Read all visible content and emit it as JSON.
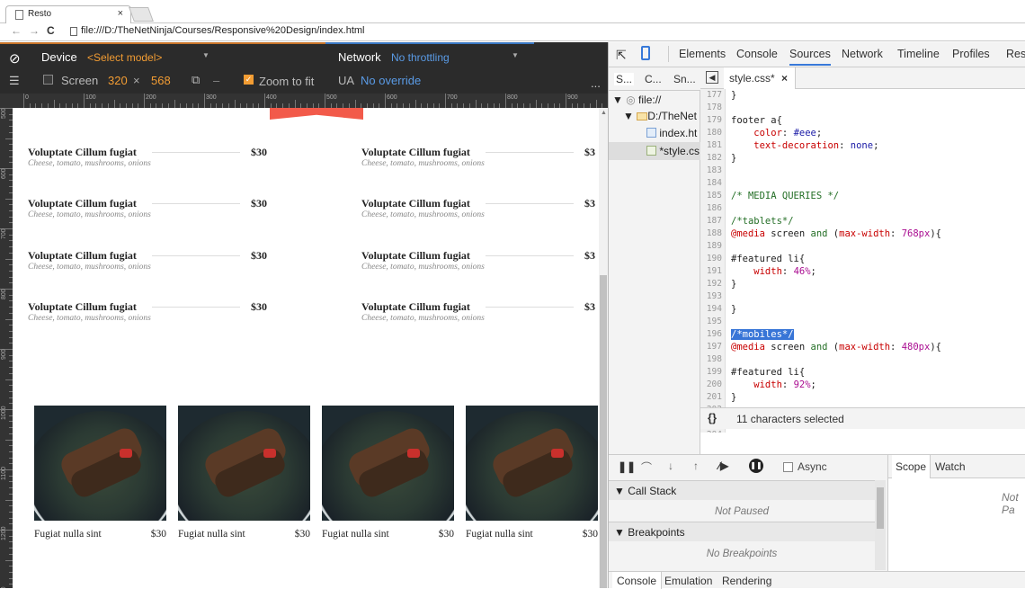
{
  "browser": {
    "tab_title": "Resto",
    "tab_close": "×",
    "url": "file:///D:/TheNetNinja/Courses/Responsive%20Design/index.html",
    "nav_icons": [
      "back-icon",
      "forward-icon",
      "reload-icon"
    ]
  },
  "device_toolbar": {
    "device_label": "Device",
    "device_value": "<Select model>",
    "network_label": "Network",
    "network_value": "No throttling",
    "screen_label": "Screen",
    "screen_width": "320",
    "screen_x": "×",
    "screen_height": "568",
    "swap_dash": "–",
    "zoom_label": "Zoom to fit",
    "ua_label": "UA",
    "ua_value": "No override",
    "more": "..."
  },
  "ruler": {
    "h_labels": [
      "0",
      "100",
      "200",
      "300",
      "400",
      "500",
      "600",
      "700",
      "800",
      "900"
    ],
    "v_labels": [
      "500",
      "600",
      "700",
      "800",
      "900",
      "1000",
      "1100",
      "1200",
      "1300"
    ]
  },
  "menu": {
    "items": [
      {
        "name": "Voluptate Cillum fugiat",
        "desc": "Cheese, tomato, mushrooms, onions",
        "price": "$30"
      },
      {
        "name": "Voluptate Cillum fugiat",
        "desc": "Cheese, tomato, mushrooms, onions",
        "price": "$3"
      },
      {
        "name": "Voluptate Cillum fugiat",
        "desc": "Cheese, tomato, mushrooms, onions",
        "price": "$30"
      },
      {
        "name": "Voluptate Cillum fugiat",
        "desc": "Cheese, tomato, mushrooms, onions",
        "price": "$3"
      },
      {
        "name": "Voluptate Cillum fugiat",
        "desc": "Cheese, tomato, mushrooms, onions",
        "price": "$30"
      },
      {
        "name": "Voluptate Cillum fugiat",
        "desc": "Cheese, tomato, mushrooms, onions",
        "price": "$3"
      },
      {
        "name": "Voluptate Cillum fugiat",
        "desc": "Cheese, tomato, mushrooms, onions",
        "price": "$30"
      },
      {
        "name": "Voluptate Cillum fugiat",
        "desc": "Cheese, tomato, mushrooms, onions",
        "price": "$3"
      }
    ]
  },
  "gallery": {
    "items": [
      {
        "caption": "Fugiat nulla sint",
        "price": "$30"
      },
      {
        "caption": "Fugiat nulla sint",
        "price": "$30"
      },
      {
        "caption": "Fugiat nulla sint",
        "price": "$30"
      },
      {
        "caption": "Fugiat nulla sint",
        "price": "$30"
      }
    ]
  },
  "devtools": {
    "tabs": [
      "Elements",
      "Console",
      "Sources",
      "Network",
      "Timeline",
      "Profiles",
      "Resou"
    ],
    "active_tab": "Sources",
    "navigator_tabs": [
      "S...",
      "C...",
      "Sn..."
    ],
    "tree": {
      "root": "file://",
      "folder": "D:/TheNet",
      "file1": "index.ht",
      "file2": "*style.cs"
    },
    "editor_tab": "style.css*",
    "editor_tab_close": "×",
    "line_numbers": [
      "177",
      "178",
      "179",
      "180",
      "181",
      "182",
      "183",
      "184",
      "185",
      "186",
      "187",
      "188",
      "189",
      "190",
      "191",
      "192",
      "193",
      "194",
      "195",
      "196",
      "197",
      "198",
      "199",
      "200",
      "201",
      "202",
      "203",
      "204"
    ],
    "code": {
      "l177": "}",
      "l179": "footer a{",
      "l180_prop": "    color",
      "l180_val": "#eee",
      "l181_prop": "    text-decoration",
      "l181_val": "none",
      "l182": "}",
      "l185": "/* MEDIA QUERIES */",
      "l187": "/*tablets*/",
      "l188_at": "@media",
      "l188_screen": " screen ",
      "l188_and": "and",
      "l188_open": " (",
      "l188_prop": "max-width",
      "l188_val": "768px",
      "l188_close": "){",
      "l190": "#featured li{",
      "l191_prop": "    width",
      "l191_val": "46%",
      "l192": "}",
      "l194": "}",
      "l196": "/*mobiles*/",
      "l197_at": "@media",
      "l197_screen": " screen ",
      "l197_and": "and",
      "l197_open": " (",
      "l197_prop": "max-width",
      "l197_val": "480px",
      "l197_close": "){",
      "l199": "#featured li{",
      "l200_prop": "    width",
      "l200_val": "92%",
      "l201": "}",
      "l203": "}"
    },
    "status": "11 characters selected",
    "pretty_print": "{}",
    "debugger": {
      "async_label": "Async",
      "call_stack": "Call Stack",
      "not_paused": "Not Paused",
      "breakpoints": "Breakpoints",
      "no_breakpoints": "No Breakpoints",
      "scope_tab": "Scope",
      "watch_tab": "Watch",
      "scope_msg": "Not Pa"
    },
    "drawer_tabs": [
      "Console",
      "Emulation",
      "Rendering"
    ]
  },
  "colors": {
    "accent_orange": "#f29c33",
    "accent_blue": "#5a9be6",
    "banner_red": "#f25a4a",
    "selection": "#3875d7"
  }
}
